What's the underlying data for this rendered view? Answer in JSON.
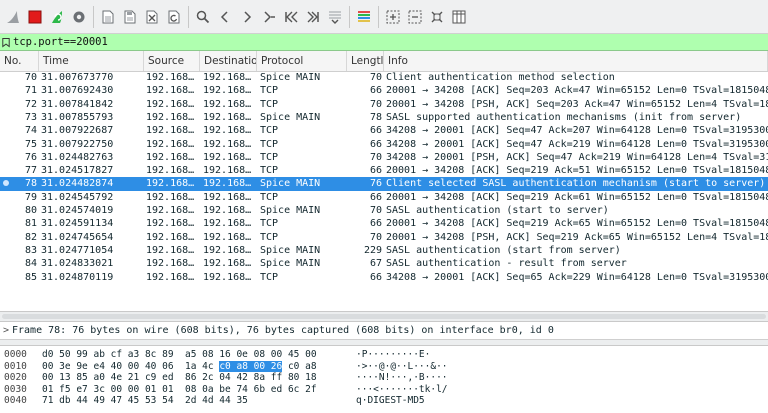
{
  "filter": {
    "value": "tcp.port==20001"
  },
  "columns": [
    "No.",
    "Time",
    "Source",
    "Destination",
    "Protocol",
    "Lengtl",
    "Info"
  ],
  "packets": [
    {
      "no": "70",
      "time": "31.007673770",
      "src": "192.168…",
      "dst": "192.168…",
      "proto": "Spice MAIN",
      "len": "70",
      "info": "Client authentication method selection"
    },
    {
      "no": "71",
      "time": "31.007692430",
      "src": "192.168…",
      "dst": "192.168…",
      "proto": "TCP",
      "len": "66",
      "info": "20001 → 34208 [ACK] Seq=203 Ack=47 Win=65152 Len=0 TSval=18150486"
    },
    {
      "no": "72",
      "time": "31.007841842",
      "src": "192.168…",
      "dst": "192.168…",
      "proto": "TCP",
      "len": "70",
      "info": "20001 → 34208 [PSH, ACK] Seq=203 Ack=47 Win=65152 Len=4 TSval=181"
    },
    {
      "no": "73",
      "time": "31.007855793",
      "src": "192.168…",
      "dst": "192.168…",
      "proto": "Spice MAIN",
      "len": "78",
      "info": "SASL supported authentication mechanisms (init from server)"
    },
    {
      "no": "74",
      "time": "31.007922687",
      "src": "192.168…",
      "dst": "192.168…",
      "proto": "TCP",
      "len": "66",
      "info": "34208 → 20001 [ACK] Seq=47 Ack=207 Win=64128 Len=0 TSval=31953008"
    },
    {
      "no": "75",
      "time": "31.007922750",
      "src": "192.168…",
      "dst": "192.168…",
      "proto": "TCP",
      "len": "66",
      "info": "34208 → 20001 [ACK] Seq=47 Ack=219 Win=64128 Len=0 TSval=31953008"
    },
    {
      "no": "76",
      "time": "31.024482763",
      "src": "192.168…",
      "dst": "192.168…",
      "proto": "TCP",
      "len": "70",
      "info": "34208 → 20001 [PSH, ACK] Seq=47 Ack=219 Win=64128 Len=4 TSval=319"
    },
    {
      "no": "77",
      "time": "31.024517827",
      "src": "192.168…",
      "dst": "192.168…",
      "proto": "TCP",
      "len": "66",
      "info": "20001 → 34208 [ACK] Seq=219 Ack=51 Win=65152 Len=0 TSval=18150486"
    },
    {
      "no": "78",
      "time": "31.024482874",
      "src": "192.168…",
      "dst": "192.168…",
      "proto": "Spice MAIN",
      "len": "76",
      "info": "Client selected SASL authentication mechanism (start to server)",
      "selected": true
    },
    {
      "no": "79",
      "time": "31.024545792",
      "src": "192.168…",
      "dst": "192.168…",
      "proto": "TCP",
      "len": "66",
      "info": "20001 → 34208 [ACK] Seq=219 Ack=61 Win=65152 Len=0 TSval=18150486"
    },
    {
      "no": "80",
      "time": "31.024574019",
      "src": "192.168…",
      "dst": "192.168…",
      "proto": "Spice MAIN",
      "len": "70",
      "info": "SASL authentication (start to server)"
    },
    {
      "no": "81",
      "time": "31.024591134",
      "src": "192.168…",
      "dst": "192.168…",
      "proto": "TCP",
      "len": "66",
      "info": "20001 → 34208 [ACK] Seq=219 Ack=65 Win=65152 Len=0 TSval=18150486"
    },
    {
      "no": "82",
      "time": "31.024745654",
      "src": "192.168…",
      "dst": "192.168…",
      "proto": "TCP",
      "len": "70",
      "info": "20001 → 34208 [PSH, ACK] Seq=219 Ack=65 Win=65152 Len=4 TSval=181"
    },
    {
      "no": "83",
      "time": "31.024771054",
      "src": "192.168…",
      "dst": "192.168…",
      "proto": "Spice MAIN",
      "len": "229",
      "info": "SASL authentication (start from server)"
    },
    {
      "no": "84",
      "time": "31.024833021",
      "src": "192.168…",
      "dst": "192.168…",
      "proto": "Spice MAIN",
      "len": "67",
      "info": "SASL authentication - result from server"
    },
    {
      "no": "85",
      "time": "31.024870119",
      "src": "192.168…",
      "dst": "192.168…",
      "proto": "TCP",
      "len": "66",
      "info": "34208 → 20001 [ACK] Seq=65 Ack=229 Win=64128 Len=0 TSval=31953008"
    }
  ],
  "detail": {
    "arrow": ">",
    "text": "Frame 78: 76 bytes on wire (608 bits), 76 bytes captured (608 bits) on interface br0, id 0"
  },
  "bytes": [
    {
      "off": "0000",
      "hex_pre": "d0 50 99 ab cf a3 8c 89  a5 08 16 0e 08 00 45 00",
      "hex_hl": "",
      "hex_post": "",
      "asc": "·P·········E·"
    },
    {
      "off": "0010",
      "hex_pre": "00 3e 9e e4 40 00 40 06  1a 4c ",
      "hex_hl": "c0 a8 00 26",
      "hex_post": " c0 a8",
      "asc": "·>··@·@··L···&··"
    },
    {
      "off": "0020",
      "hex_pre": "00 13 85 a0 4e 21 c9 ed  86 2c 04 42 8a ff 80 18",
      "hex_hl": "",
      "hex_post": "",
      "asc": "····N!···,·B····"
    },
    {
      "off": "0030",
      "hex_pre": "01 f5 e7 3c 00 00 01 01  08 0a be 74 6b ed 6c 2f",
      "hex_hl": "",
      "hex_post": "",
      "asc": "···<·······tk·l/"
    },
    {
      "off": "0040",
      "hex_pre": "71 db 44 49 47 45 53 54  2d 4d 44 35",
      "hex_hl": "",
      "hex_post": "",
      "asc": "q·DIGEST-MD5"
    }
  ],
  "toolbar": [
    "shark-fin-icon",
    "stop-icon",
    "restart-icon",
    "options-gear-icon",
    "open-file-icon",
    "save-file-icon",
    "close-file-icon",
    "reload-icon",
    "find-icon",
    "back-icon",
    "forward-icon",
    "go-to-packet-icon",
    "first-packet-icon",
    "last-packet-icon",
    "autoscroll-icon",
    "colorize-icon",
    "zoom-in-icon",
    "zoom-out-icon",
    "normal-size-icon",
    "resize-columns-icon"
  ],
  "colors": {
    "selected": "#2e8ee5",
    "filter_ok": "#afffaf"
  }
}
